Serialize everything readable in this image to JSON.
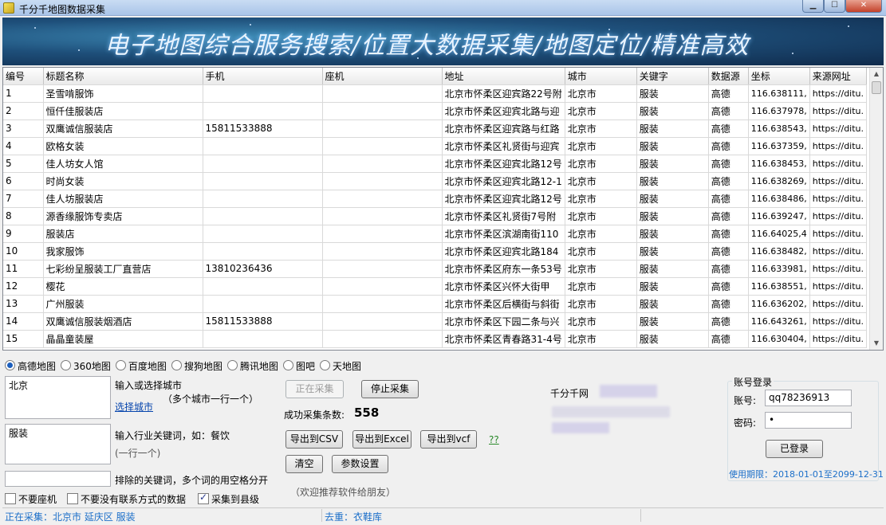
{
  "window": {
    "title": "千分千地图数据采集"
  },
  "banner": {
    "text": "电子地图综合服务搜索/位置大数据采集/地图定位/精准高效"
  },
  "grid": {
    "columns": [
      "编号",
      "标题名称",
      "手机",
      "座机",
      "地址",
      "城市",
      "关键字",
      "数据源",
      "坐标",
      "来源网址"
    ],
    "rows": [
      [
        "1",
        "圣雪啃服饰",
        "",
        "",
        "北京市怀柔区迎宾路22号附",
        "北京市",
        "服装",
        "高德",
        "116.638111,",
        "https://ditu."
      ],
      [
        "2",
        "恒仟佳服装店",
        "",
        "",
        "北京市怀柔区迎宾北路与迎",
        "北京市",
        "服装",
        "高德",
        "116.637978,",
        "https://ditu."
      ],
      [
        "3",
        "双鹰诚信服装店",
        "15811533888",
        "",
        "北京市怀柔区迎宾路与红路",
        "北京市",
        "服装",
        "高德",
        "116.638543,",
        "https://ditu."
      ],
      [
        "4",
        "欧格女装",
        "",
        "",
        "北京市怀柔区礼贤街与迎宾",
        "北京市",
        "服装",
        "高德",
        "116.637359,",
        "https://ditu."
      ],
      [
        "5",
        "佳人坊女人馆",
        "",
        "",
        "北京市怀柔区迎宾北路12号",
        "北京市",
        "服装",
        "高德",
        "116.638453,",
        "https://ditu."
      ],
      [
        "6",
        "时尚女装",
        "",
        "",
        "北京市怀柔区迎宾北路12-1",
        "北京市",
        "服装",
        "高德",
        "116.638269,",
        "https://ditu."
      ],
      [
        "7",
        "佳人坊服装店",
        "",
        "",
        "北京市怀柔区迎宾北路12号",
        "北京市",
        "服装",
        "高德",
        "116.638486,",
        "https://ditu."
      ],
      [
        "8",
        "源香缘服饰专卖店",
        "",
        "",
        "北京市怀柔区礼贤街7号附",
        "北京市",
        "服装",
        "高德",
        "116.639247,",
        "https://ditu."
      ],
      [
        "9",
        "服装店",
        "",
        "",
        "北京市怀柔区滨湖南街110",
        "北京市",
        "服装",
        "高德",
        "116.64025,4",
        "https://ditu."
      ],
      [
        "10",
        "我家服饰",
        "",
        "",
        "北京市怀柔区迎宾北路184",
        "北京市",
        "服装",
        "高德",
        "116.638482,",
        "https://ditu."
      ],
      [
        "11",
        "七彩纷呈服装工厂直营店",
        "13810236436",
        "",
        "北京市怀柔区府东一条53号",
        "北京市",
        "服装",
        "高德",
        "116.633981,",
        "https://ditu."
      ],
      [
        "12",
        "樱花",
        "",
        "",
        "北京市怀柔区兴怀大街甲",
        "北京市",
        "服装",
        "高德",
        "116.638551,",
        "https://ditu."
      ],
      [
        "13",
        "广州服装",
        "",
        "",
        "北京市怀柔区后横街与斜街",
        "北京市",
        "服装",
        "高德",
        "116.636202,",
        "https://ditu."
      ],
      [
        "14",
        "双鹰诚信服装烟酒店",
        "15811533888",
        "",
        "北京市怀柔区下园二条与兴",
        "北京市",
        "服装",
        "高德",
        "116.643261,",
        "https://ditu."
      ],
      [
        "15",
        "晶晶童装屋",
        "",
        "",
        "北京市怀柔区青春路31-4号",
        "北京市",
        "服装",
        "高德",
        "116.630404,",
        "https://ditu."
      ]
    ]
  },
  "map_sources": [
    {
      "label": "高德地图",
      "selected": true
    },
    {
      "label": "360地图",
      "selected": false
    },
    {
      "label": "百度地图",
      "selected": false
    },
    {
      "label": "搜狗地图",
      "selected": false
    },
    {
      "label": "腾讯地图",
      "selected": false
    },
    {
      "label": "图吧",
      "selected": false
    },
    {
      "label": "天地图",
      "selected": false
    }
  ],
  "city": {
    "value": "北京",
    "hint": "输入或选择城市",
    "hint2": "（多个城市一行一个）",
    "select_link": "选择城市"
  },
  "keyword": {
    "value": "服装",
    "hint": "输入行业关键词，如：餐饮",
    "hint2": "(一行一个)"
  },
  "exclude": {
    "value": "",
    "hint": "排除的关键词，多个词的用空格分开"
  },
  "options": {
    "no_landline": "不要座机",
    "no_contact": "不要没有联系方式的数据",
    "county_level": "采集到县级"
  },
  "actions": {
    "collecting": "正在采集",
    "stop": "停止采集",
    "success_label": "成功采集条数:",
    "success_count": "558",
    "export_csv": "导出到CSV",
    "export_excel": "导出到Excel",
    "export_vcf": "导出到vcf",
    "qq_link": "??",
    "clear": "清空",
    "settings": "参数设置",
    "recommend": "（欢迎推荐软件给朋友）"
  },
  "brand": {
    "name": "千分千网"
  },
  "login": {
    "title": "账号登录",
    "account_label": "账号:",
    "account_value": "qq78236913",
    "password_label": "密码:",
    "password_value": "•",
    "login_button": "已登录",
    "validity": "使用期限：2018-01-01至2099-12-31"
  },
  "status": {
    "collecting": "正在采集：北京市 延庆区 服装",
    "dedup": "去重：衣鞋库"
  }
}
